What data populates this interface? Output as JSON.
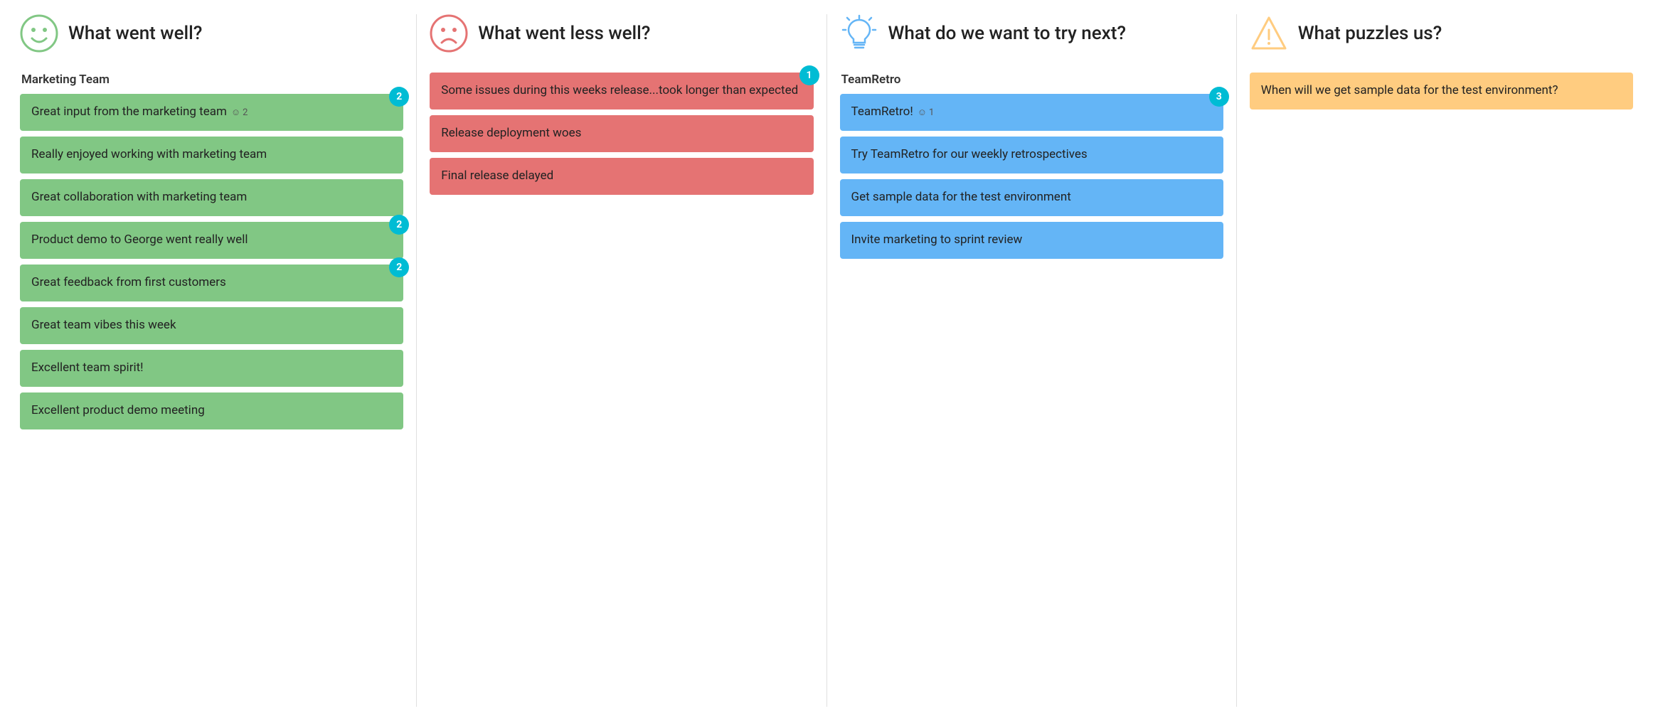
{
  "columns": [
    {
      "id": "went-well",
      "title": "What went well?",
      "icon": "smiley",
      "iconColor": "#81c784",
      "sections": [
        {
          "label": "Marketing Team",
          "cards": [
            {
              "text": "Great input from the marketing team",
              "votes": 2,
              "badge": 2,
              "voteIcon": true
            },
            {
              "text": "Really enjoyed working with marketing team",
              "votes": null,
              "badge": null
            },
            {
              "text": "Great collaboration with marketing team",
              "votes": null,
              "badge": null
            }
          ]
        },
        {
          "label": "",
          "cards": [
            {
              "text": "Product demo to George went really well",
              "votes": null,
              "badge": 2
            },
            {
              "text": "Great feedback from first customers",
              "votes": null,
              "badge": 2
            },
            {
              "text": "Great team vibes this week",
              "votes": null,
              "badge": null
            },
            {
              "text": "Excellent team spirit!",
              "votes": null,
              "badge": null
            },
            {
              "text": "Excellent product demo meeting",
              "votes": null,
              "badge": null
            }
          ]
        }
      ],
      "cardColor": "card-green"
    },
    {
      "id": "went-less-well",
      "title": "What went less well?",
      "icon": "sad",
      "iconColor": "#e57373",
      "sections": [
        {
          "label": "",
          "cards": [
            {
              "text": "Some issues during this weeks release...took longer than expected",
              "votes": null,
              "badge": 1
            },
            {
              "text": "Release deployment woes",
              "votes": null,
              "badge": null
            },
            {
              "text": "Final release delayed",
              "votes": null,
              "badge": null
            }
          ]
        }
      ],
      "cardColor": "card-red"
    },
    {
      "id": "try-next",
      "title": "What do we want to try next?",
      "icon": "bulb",
      "iconColor": "#64b5f6",
      "sections": [
        {
          "label": "TeamRetro",
          "cards": [
            {
              "text": "TeamRetro!",
              "votes": 1,
              "badge": 3,
              "voteIcon": true
            },
            {
              "text": "Try TeamRetro for our weekly retrospectives",
              "votes": null,
              "badge": null
            },
            {
              "text": "Get sample data for the test environment",
              "votes": null,
              "badge": null
            },
            {
              "text": "Invite marketing to sprint review",
              "votes": null,
              "badge": null
            }
          ]
        }
      ],
      "cardColor": "card-blue"
    },
    {
      "id": "puzzles",
      "title": "What puzzles us?",
      "icon": "warning",
      "iconColor": "#ffcc80",
      "sections": [
        {
          "label": "",
          "cards": [
            {
              "text": "When will we get sample data for the test environment?",
              "votes": null,
              "badge": null
            }
          ]
        }
      ],
      "cardColor": "card-orange"
    }
  ]
}
